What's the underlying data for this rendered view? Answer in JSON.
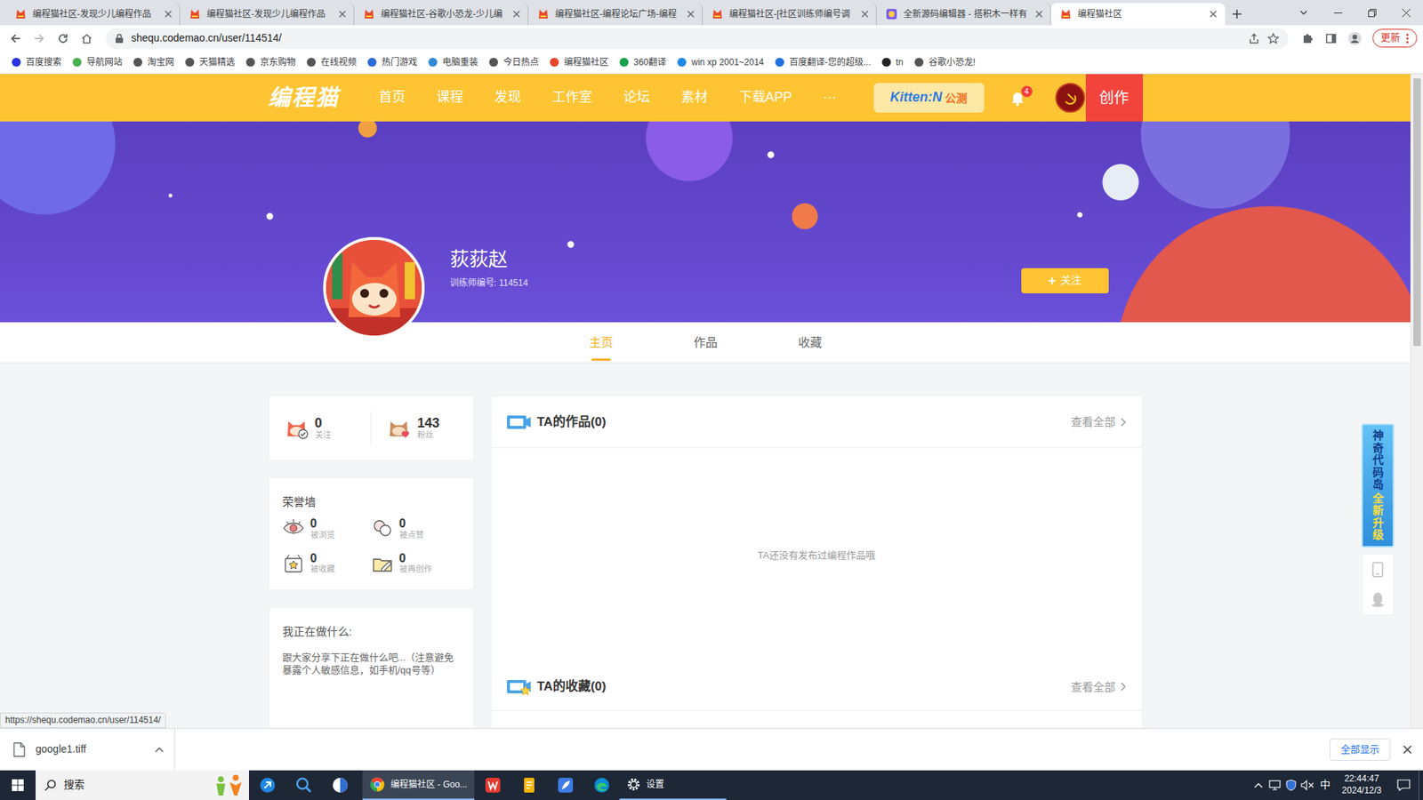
{
  "browser": {
    "tabs": [
      {
        "title": "编程猫社区-发现少儿编程作品",
        "kind": "site",
        "selected": false
      },
      {
        "title": "编程猫社区-发现少儿编程作品",
        "kind": "site",
        "selected": false
      },
      {
        "title": "编程猫社区-谷歌小恐龙-少儿编",
        "kind": "site",
        "selected": false
      },
      {
        "title": "编程猫社区-编程论坛广场-编程",
        "kind": "site",
        "selected": false
      },
      {
        "title": "编程猫社区-[社区训练师编号调",
        "kind": "site",
        "selected": false
      },
      {
        "title": "全新源码编辑器 - 搭积木一样有",
        "kind": "editor",
        "selected": false
      },
      {
        "title": "编程猫社区",
        "kind": "site",
        "selected": true
      }
    ],
    "url": "shequ.codemao.cn/user/114514/",
    "update": "更新",
    "bookmarks": [
      "百度搜索",
      "导航网站",
      "淘宝网",
      "天猫精选",
      "京东购物",
      "在线视频",
      "热门游戏",
      "电脑重装",
      "今日热点",
      "编程猫社区",
      "360翻译",
      "win xp 2001~2014",
      "百度翻译-您的超级...",
      "tn",
      "谷歌小恐龙!"
    ],
    "link_preview": "https://shequ.codemao.cn/user/114514/"
  },
  "site": {
    "logo": "编程猫",
    "nav": [
      "首页",
      "课程",
      "发现",
      "工作室",
      "论坛",
      "素材",
      "下载APP",
      "···"
    ],
    "kitten": "Kitten:N",
    "kitten_tag": "公测",
    "notifications": "4",
    "create": "创作"
  },
  "profile": {
    "name": "荻荻赵",
    "trainer": "训练师编号: 114514",
    "follow_icon": "+",
    "follow": "关注"
  },
  "profile_tabs": [
    {
      "label": "主页",
      "selected": true
    },
    {
      "label": "作品",
      "selected": false
    },
    {
      "label": "收藏",
      "selected": false
    }
  ],
  "stats": [
    {
      "value": "0",
      "label": "关注"
    },
    {
      "value": "143",
      "label": "粉丝"
    }
  ],
  "honor": {
    "title": "荣誉墙",
    "items": [
      {
        "value": "0",
        "label": "被浏览"
      },
      {
        "value": "0",
        "label": "被点赞"
      },
      {
        "value": "0",
        "label": "被收藏"
      },
      {
        "value": "0",
        "label": "被再创作"
      }
    ]
  },
  "doing": {
    "title": "我正在做什么:",
    "hint": "跟大家分享下正在做什么吧...（注意避免暴露个人敏感信息，如手机/qq号等）"
  },
  "works": {
    "title": "TA的作品(0)",
    "more": "查看全部",
    "empty": "TA还没有发布过编程作品哦"
  },
  "favorites": {
    "title": "TA的收藏(0)",
    "more": "查看全部"
  },
  "promo": [
    "神奇代码岛",
    "全新升级"
  ],
  "scrollbar": {
    "level": 0.42
  },
  "download": {
    "file": "google1.tiff",
    "show_all": "全部显示"
  },
  "taskbar": {
    "search": "搜索",
    "apps": [
      {
        "label": "编程猫社区 - Goo...",
        "kind": "browser",
        "selected": true
      },
      {
        "label": "设置",
        "kind": "settings",
        "selected": false
      }
    ],
    "ime": "中",
    "time": "22:44:47",
    "date": "2024/12/3"
  }
}
